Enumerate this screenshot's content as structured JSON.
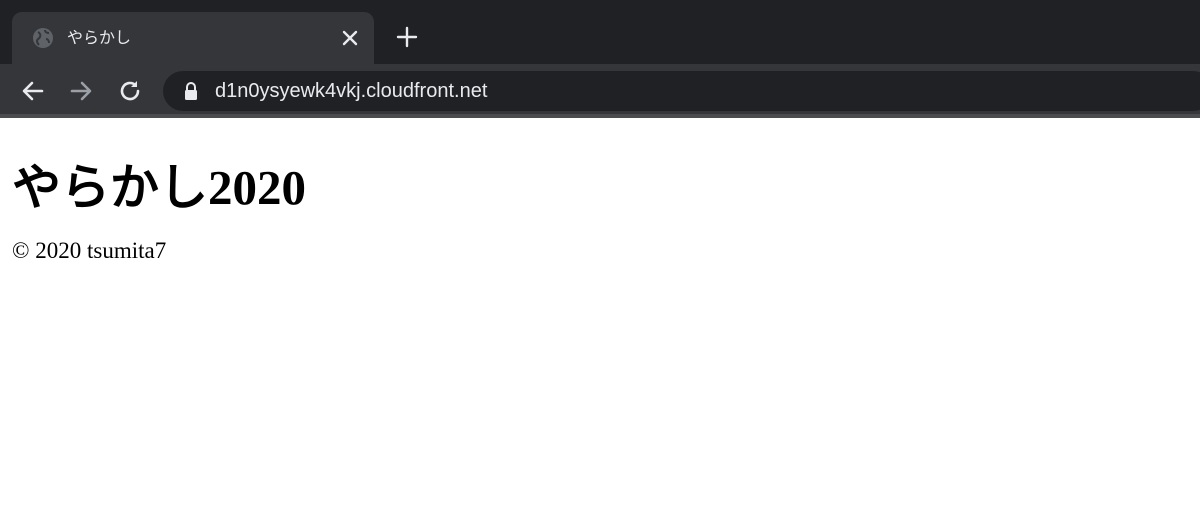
{
  "browser": {
    "tab": {
      "title": "やらかし",
      "favicon_icon": "globe-icon",
      "close_icon": "close-icon"
    },
    "new_tab_icon": "plus-icon",
    "toolbar": {
      "back_icon": "arrow-left-icon",
      "forward_icon": "arrow-right-icon",
      "reload_icon": "reload-icon",
      "lock_icon": "lock-icon",
      "url": "d1n0ysyewk4vkj.cloudfront.net"
    },
    "colors": {
      "frame": "#202124",
      "active_tab": "#35363a",
      "text": "#e8eaed",
      "disabled_icon": "#9aa0a6"
    }
  },
  "page": {
    "title": "やらかし2020",
    "footer": "© 2020 tsumita7"
  }
}
